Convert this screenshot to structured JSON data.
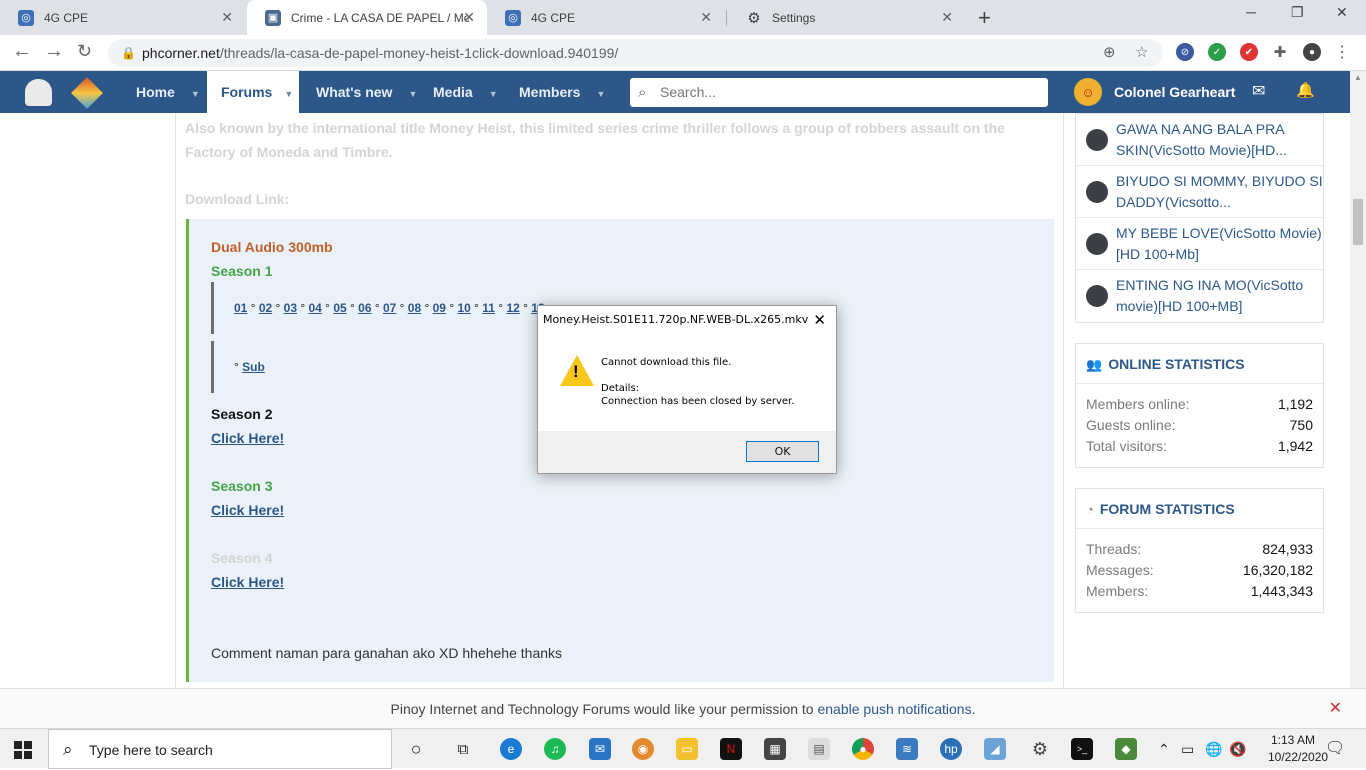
{
  "browser": {
    "tabs": [
      {
        "title": "4G CPE",
        "icon": "globe-icon"
      },
      {
        "title": "Crime - LA CASA DE PAPEL / Mo",
        "icon": "phcorner-icon"
      },
      {
        "title": "4G CPE",
        "icon": "globe-icon"
      },
      {
        "title": "Settings",
        "icon": "gear-icon"
      }
    ],
    "url_domain": "phcorner.net",
    "url_path": "/threads/la-casa-de-papel-money-heist-1click-download.940199/"
  },
  "site_nav": {
    "items": [
      {
        "label": "Home"
      },
      {
        "label": "Forums"
      },
      {
        "label": "What's new"
      },
      {
        "label": "Media"
      },
      {
        "label": "Members"
      }
    ],
    "search_placeholder": "Search...",
    "username": "Colonel Gearheart"
  },
  "post": {
    "intro_line1": "Also known by the international title Money Heist, this limited series crime thriller follows a group of robbers assault on the",
    "intro_line2": "Factory of Moneda and Timbre.",
    "download_label": "Download Link:",
    "dual_audio": "Dual Audio 300mb",
    "season1": "Season 1",
    "episodes": [
      "01",
      "02",
      "03",
      "04",
      "05",
      "06",
      "07",
      "08",
      "09",
      "10",
      "11",
      "12",
      "13"
    ],
    "episode_sep": "°",
    "sub_prefix": "°",
    "sub_label": "Sub",
    "season2": "Season 2",
    "season3": "Season 3",
    "season4": "Season 4",
    "click_here": "Click Here!",
    "comment": "Comment naman para ganahan ako XD hhehehe thanks"
  },
  "sidebar": {
    "threads": [
      {
        "title": "GAWA NA ANG BALA PRA SKIN(VicSotto Movie)[HD..."
      },
      {
        "title": "BIYUDO SI MOMMY, BIYUDO SI DADDY(Vicsotto..."
      },
      {
        "title": "MY BEBE LOVE(VicSotto Movie) [HD 100+Mb]"
      },
      {
        "title": "ENTING NG INA MO(VicSotto movie)[HD 100+MB]"
      }
    ],
    "online": {
      "title": "ONLINE STATISTICS",
      "rows": [
        {
          "k": "Members online:",
          "v": "1,192"
        },
        {
          "k": "Guests online:",
          "v": "750"
        },
        {
          "k": "Total visitors:",
          "v": "1,942"
        }
      ]
    },
    "forum": {
      "title": "FORUM STATISTICS",
      "rows": [
        {
          "k": "Threads:",
          "v": "824,933"
        },
        {
          "k": "Messages:",
          "v": "16,320,182"
        },
        {
          "k": "Members:",
          "v": "1,443,343"
        }
      ]
    }
  },
  "notice": {
    "text": "Pinoy Internet and Technology Forums would like your permission to",
    "link": "enable push notifications",
    "end": "."
  },
  "dialog": {
    "title": "Money.Heist.S01E11.720p.NF.WEB-DL.x265.mkv",
    "message": "Cannot download this file.",
    "details_label": "Details:",
    "details": "Connection has been closed by server.",
    "ok": "OK"
  },
  "taskbar": {
    "search_placeholder": "Type here to search",
    "time": "1:13 AM",
    "date": "10/22/2020"
  },
  "colors": {
    "nav_blue": "#2d5789",
    "accent_green": "#6db33f",
    "orange_title": "#c0602a",
    "season_green": "#47a447"
  }
}
